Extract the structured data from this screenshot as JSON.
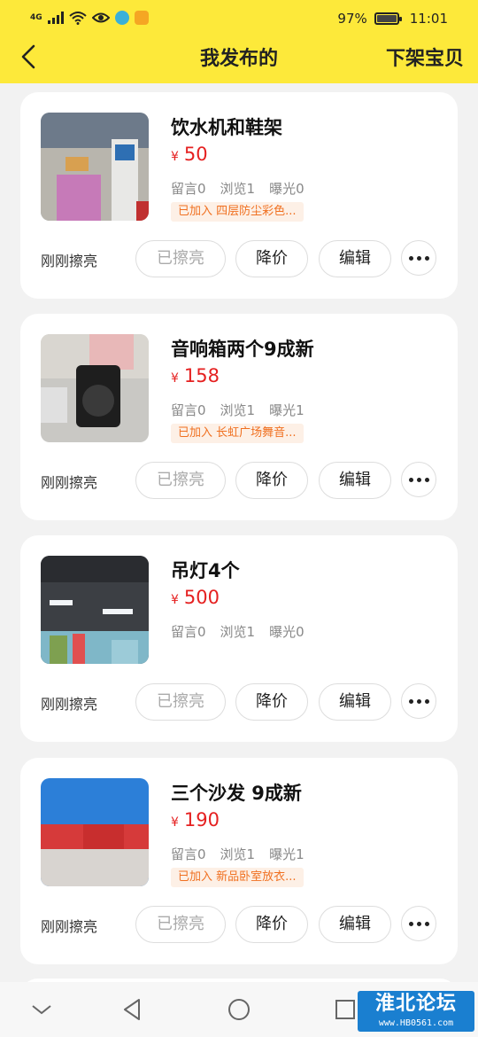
{
  "status_bar": {
    "network": "4G",
    "battery": "97%",
    "time": "11:01"
  },
  "nav": {
    "title": "我发布的",
    "action": "下架宝贝"
  },
  "items": [
    {
      "title": "饮水机和鞋架",
      "currency": "¥",
      "price": "50",
      "comments": "留言0",
      "views": "浏览1",
      "exposure": "曝光0",
      "tag": "已加入 四层防尘彩色...",
      "refresh_status": "刚刚擦亮",
      "buttons": [
        "已擦亮",
        "降价",
        "编辑"
      ]
    },
    {
      "title": "音响箱两个9成新",
      "currency": "¥",
      "price": "158",
      "comments": "留言0",
      "views": "浏览1",
      "exposure": "曝光1",
      "tag": "已加入 长虹广场舞音...",
      "refresh_status": "刚刚擦亮",
      "buttons": [
        "已擦亮",
        "降价",
        "编辑"
      ]
    },
    {
      "title": "吊灯4个",
      "currency": "¥",
      "price": "500",
      "comments": "留言0",
      "views": "浏览1",
      "exposure": "曝光0",
      "tag": "",
      "refresh_status": "刚刚擦亮",
      "buttons": [
        "已擦亮",
        "降价",
        "编辑"
      ]
    },
    {
      "title": "三个沙发 9成新",
      "currency": "¥",
      "price": "190",
      "comments": "留言0",
      "views": "浏览1",
      "exposure": "曝光1",
      "tag": "已加入 新品卧室放衣...",
      "refresh_status": "刚刚擦亮",
      "buttons": [
        "已擦亮",
        "降价",
        "编辑"
      ]
    }
  ],
  "watermark": {
    "main": "淮北论坛",
    "url": "www.HB0561.com"
  },
  "colors": {
    "header_bg": "#fde93a",
    "price": "#e52020",
    "tag_text": "#f07020",
    "tag_bg": "#fdf0e6"
  }
}
